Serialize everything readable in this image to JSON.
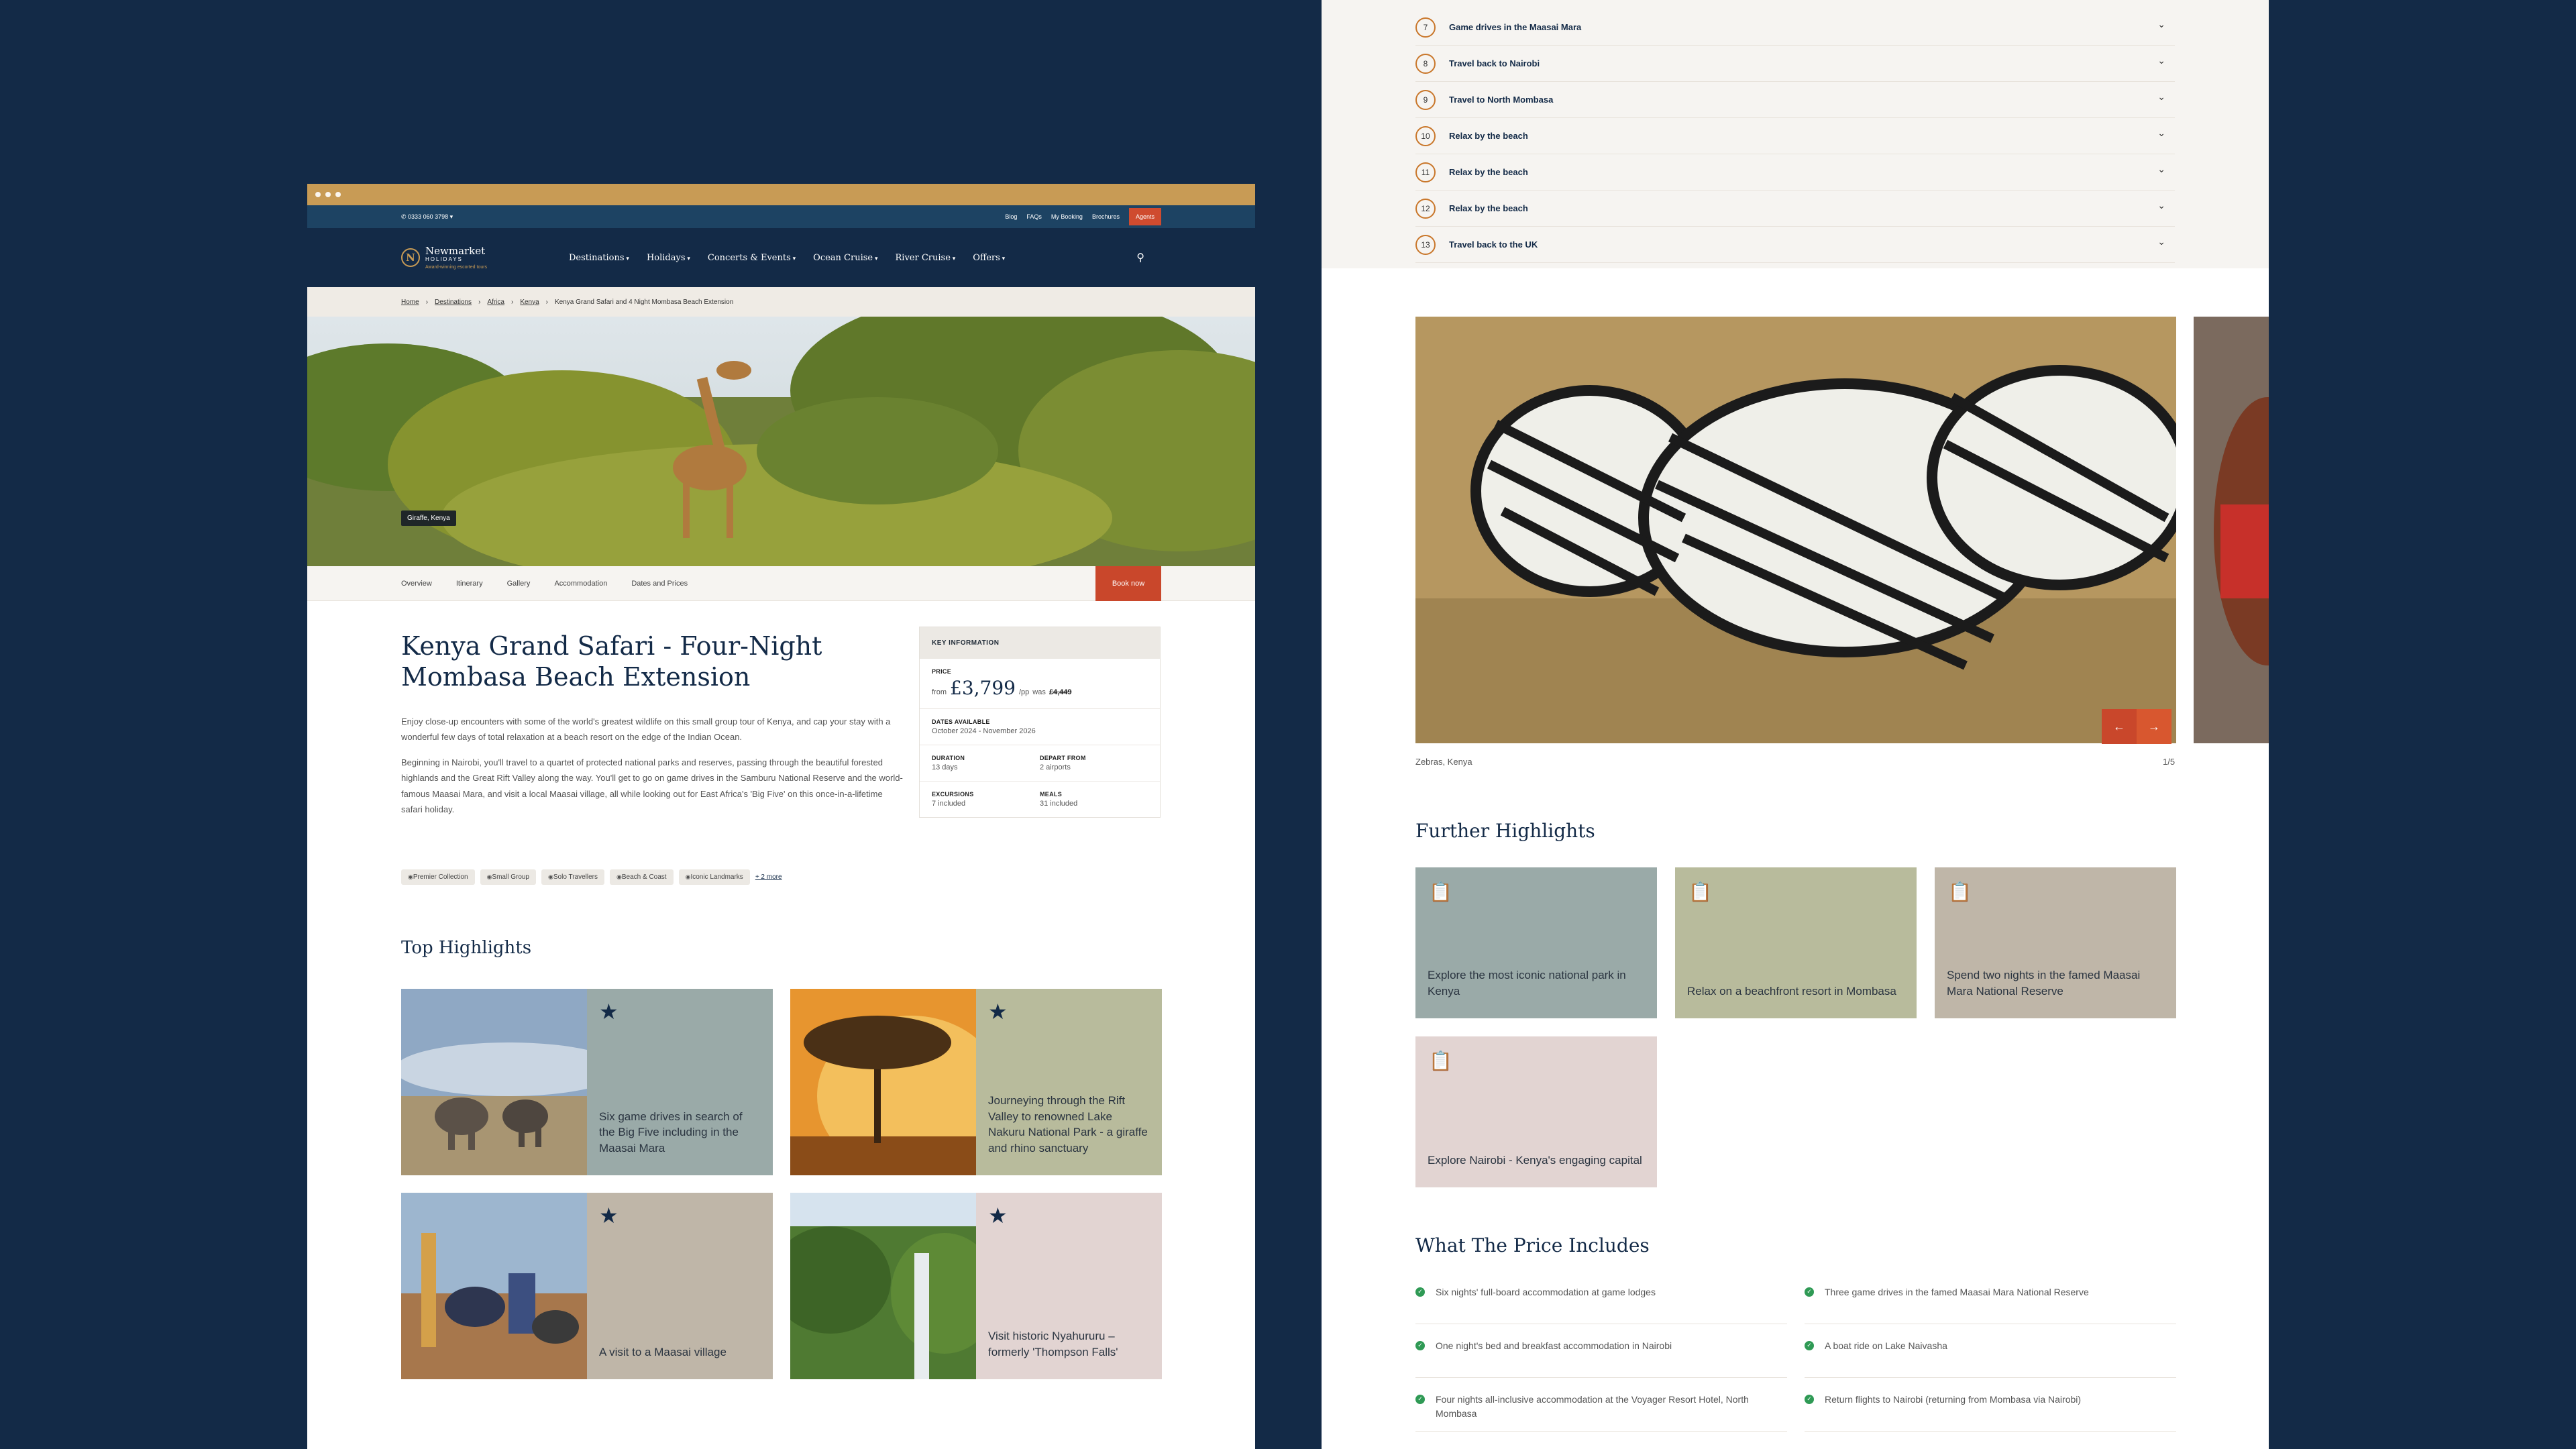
{
  "topbar": {
    "phone": "0333 060 3798 ▾",
    "links": [
      "Blog",
      "FAQs",
      "My Booking",
      "Brochures"
    ],
    "agents": "Agents"
  },
  "logo": {
    "name": "Newmarket",
    "sub": "HOLIDAYS",
    "tagline": "Award-winning escorted tours"
  },
  "nav": [
    "Destinations",
    "Holidays",
    "Concerts & Events",
    "Ocean Cruise",
    "River Cruise",
    "Offers"
  ],
  "breadcrumb": {
    "items": [
      "Home",
      "Destinations",
      "Africa",
      "Kenya"
    ],
    "current": "Kenya Grand Safari and 4 Night Mombasa Beach Extension"
  },
  "hero": {
    "caption": "Giraffe, Kenya"
  },
  "subnav": {
    "tabs": [
      "Overview",
      "Itinerary",
      "Gallery",
      "Accommodation",
      "Dates and Prices"
    ],
    "book": "Book now"
  },
  "tour": {
    "title": "Kenya Grand Safari - Four-Night Mombasa Beach Extension",
    "intro1": "Enjoy close-up encounters with some of the world's greatest wildlife on this small group tour of Kenya, and cap your stay with a wonderful few days of total relaxation at a beach resort on the edge of the Indian Ocean.",
    "intro2": "Beginning in Nairobi, you'll travel to a quartet of protected national parks and reserves, passing through the beautiful forested highlands and the Great Rift Valley along the way. You'll get to go on game drives in the Samburu National Reserve and the world-famous Maasai Mara, and visit a local Maasai village, all while looking out for East Africa's 'Big Five' on this once-in-a-lifetime safari holiday.",
    "tags": [
      "Premier Collection",
      "Small Group",
      "Solo Travellers",
      "Beach & Coast",
      "Iconic Landmarks"
    ],
    "more": "+ 2 more"
  },
  "key": {
    "header": "KEY INFORMATION",
    "price_label": "PRICE",
    "from": "from",
    "price": "£3,799",
    "pp": "/pp",
    "was_label": "was",
    "was": "£4,449",
    "dates_label": "DATES AVAILABLE",
    "dates": "October 2024 - November 2026",
    "duration_label": "DURATION",
    "duration": "13 days",
    "depart_label": "DEPART FROM",
    "depart": "2 airports",
    "excursions_label": "EXCURSIONS",
    "excursions": "7 included",
    "meals_label": "MEALS",
    "meals": "31 included"
  },
  "top_highlights": {
    "title": "Top Highlights",
    "items": [
      "Six game drives in search of the Big Five including in the Maasai Mara",
      "Journeying through the Rift Valley to renowned Lake Nakuru National Park - a giraffe and rhino sanctuary",
      "A visit to a Maasai village",
      "Visit historic Nyahururu – formerly 'Thompson Falls'"
    ],
    "colors": [
      "#9aaaa8",
      "#b8bb9c",
      "#bfb6a8",
      "#e2d4d2"
    ]
  },
  "itinerary": [
    {
      "n": "7",
      "label": "Game drives in the Maasai Mara"
    },
    {
      "n": "8",
      "label": "Travel back to Nairobi"
    },
    {
      "n": "9",
      "label": "Travel to North Mombasa"
    },
    {
      "n": "10",
      "label": "Relax by the beach"
    },
    {
      "n": "11",
      "label": "Relax by the beach"
    },
    {
      "n": "12",
      "label": "Relax by the beach"
    },
    {
      "n": "13",
      "label": "Travel back to the UK"
    }
  ],
  "gallery": {
    "caption": "Zebras, Kenya",
    "count": "1/5"
  },
  "further": {
    "title": "Further Highlights",
    "items": [
      "Explore the most iconic national park in Kenya",
      "Relax on a beachfront resort in Mombasa",
      "Spend two nights in the famed Maasai Mara National Reserve",
      "Explore Nairobi - Kenya's engaging capital"
    ],
    "colors": [
      "#9aaaa8",
      "#b8bb9c",
      "#bfb6a8",
      "#e2d4d2"
    ]
  },
  "includes": {
    "title": "What The Price Includes",
    "items": [
      "Six nights' full-board accommodation at game lodges",
      "Three game drives in the famed Maasai Mara National Reserve",
      "One night's bed and breakfast accommodation in Nairobi",
      "A boat ride on Lake Naivasha",
      "Four nights all-inclusive accommodation at the Voyager Resort Hotel, North Mombasa",
      "Return flights to Nairobi (returning from Mombasa via Nairobi)"
    ]
  }
}
